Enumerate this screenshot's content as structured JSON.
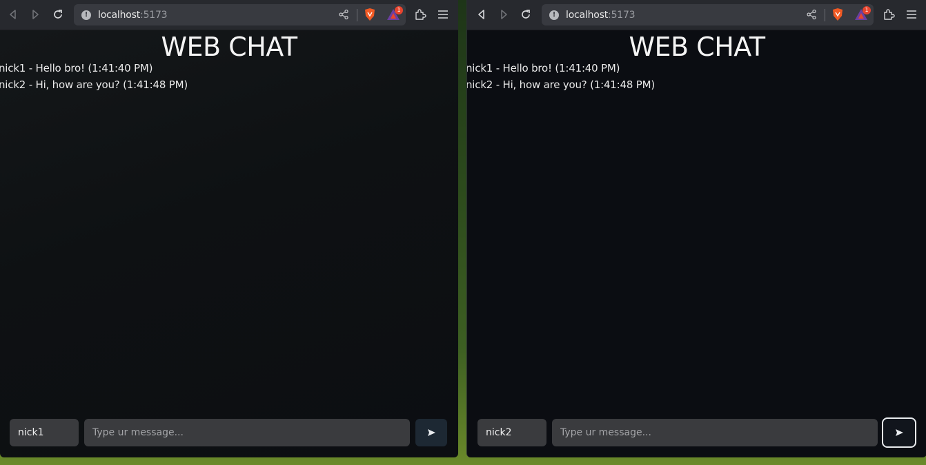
{
  "windows": [
    {
      "url_host": "localhost",
      "url_port": ":5173",
      "badge_count": "1",
      "title": "WEB CHAT",
      "messages": [
        "nick1 - Hello bro! (1:41:40 PM)",
        "nick2 - Hi, how are you? (1:41:48 PM)"
      ],
      "nickname_value": "nick1",
      "message_placeholder": "Type ur message..."
    },
    {
      "url_host": "localhost",
      "url_port": ":5173",
      "badge_count": "1",
      "title": "WEB CHAT",
      "messages": [
        "nick1 - Hello bro! (1:41:40 PM)",
        "nick2 - Hi, how are you? (1:41:48 PM)"
      ],
      "nickname_value": "nick2",
      "message_placeholder": "Type ur message..."
    }
  ],
  "colors": {
    "toolbar": "#27292e",
    "urlbar": "#383a40",
    "page_bg": "#0b0d12",
    "input_bg": "#3a3b3e",
    "brave_orange": "#f15a24",
    "badge_red": "#e8442e"
  },
  "icons": [
    "back-icon",
    "forward-icon",
    "reload-icon",
    "site-info-icon",
    "share-icon",
    "brave-shields-icon",
    "brave-rewards-icon",
    "extensions-icon",
    "menu-icon",
    "send-icon"
  ]
}
